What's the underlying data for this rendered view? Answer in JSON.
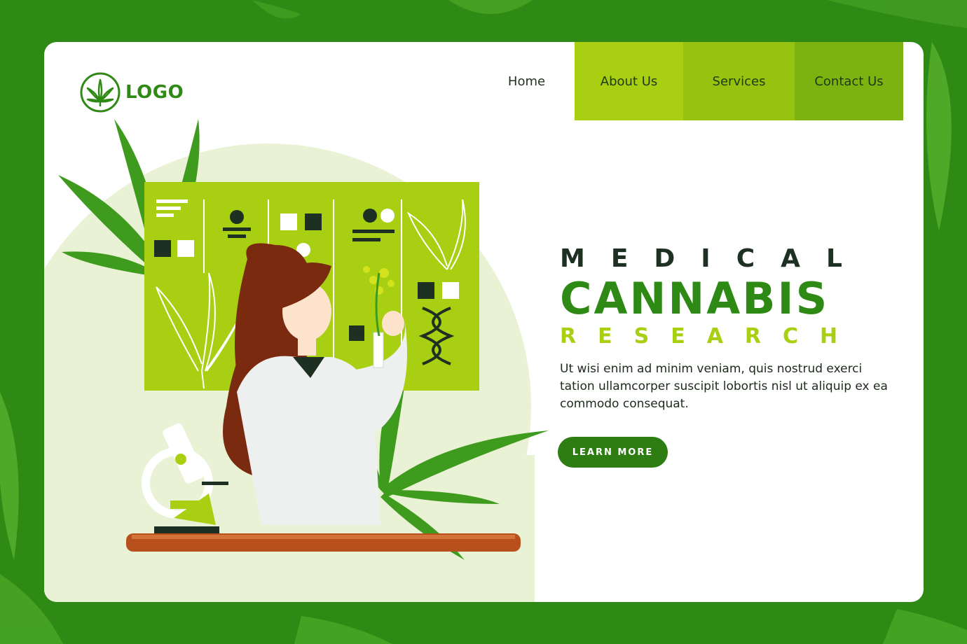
{
  "brand": {
    "logo_text": "LOGO",
    "icon": "cannabis-leaf-icon"
  },
  "nav": {
    "items": [
      {
        "label": "Home"
      },
      {
        "label": "About Us"
      },
      {
        "label": "Services"
      },
      {
        "label": "Contact Us"
      }
    ]
  },
  "hero": {
    "title_line1": "MEDICAL",
    "title_line2": "CANNABIS",
    "title_line3": "RESEARCH",
    "description": "Ut wisi enim ad minim veniam, quis nostrud exerci tation ullamcorper suscipit lobortis nisl ut aliquip ex ea commodo consequat.",
    "cta_label": "LEARN MORE"
  },
  "colors": {
    "brand_green": "#2e8a14",
    "lime": "#a8cf12",
    "lime_mid": "#97c20f",
    "lime_dark": "#7db311",
    "dark_text": "#1d3021",
    "cta_bg": "#2e7d12"
  },
  "illustration": {
    "icons": [
      "cannabis-leaf-icon",
      "microscope-icon",
      "dna-icon",
      "scientist-figure",
      "research-board"
    ]
  }
}
